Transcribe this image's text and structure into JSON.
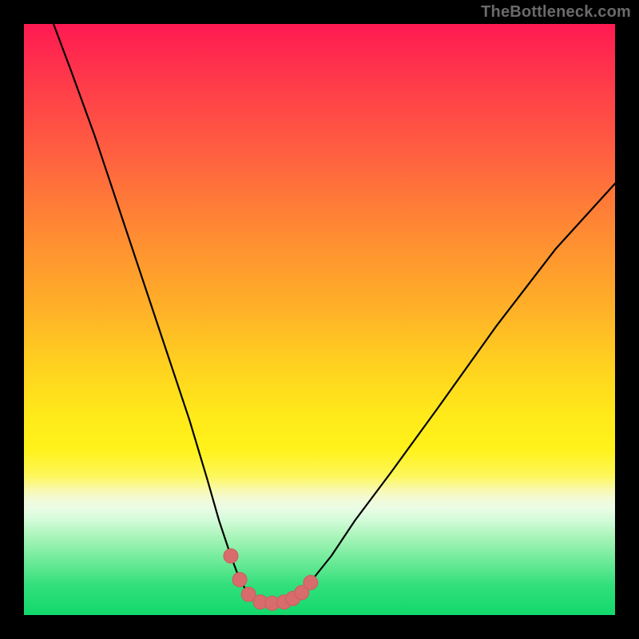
{
  "watermark": {
    "text": "TheBottleneck.com"
  },
  "colors": {
    "curve_stroke": "#000000",
    "marker_fill": "#d86b6b",
    "marker_stroke": "#c95e5e"
  },
  "chart_data": {
    "type": "line",
    "title": "",
    "xlabel": "",
    "ylabel": "",
    "xlim": [
      0,
      100
    ],
    "ylim": [
      0,
      100
    ],
    "series": [
      {
        "name": "bottleneck-curve",
        "x": [
          5,
          8,
          12,
          16,
          20,
          24,
          28,
          31,
          33,
          35,
          36.5,
          38,
          40,
          42,
          44,
          46,
          48,
          52,
          56,
          62,
          70,
          80,
          90,
          100
        ],
        "y": [
          100,
          92,
          81,
          69,
          57,
          45,
          33,
          23,
          16,
          10,
          6,
          3.5,
          2.2,
          2.0,
          2.2,
          3.2,
          5.0,
          10,
          16,
          24,
          35,
          49,
          62,
          73
        ]
      }
    ],
    "markers": {
      "name": "highlighted-points",
      "x": [
        35.0,
        36.5,
        38.0,
        40.0,
        42.0,
        44.0,
        45.5,
        47.0,
        48.5
      ],
      "y": [
        10.0,
        6.0,
        3.5,
        2.2,
        2.0,
        2.2,
        2.8,
        3.8,
        5.5
      ]
    }
  }
}
